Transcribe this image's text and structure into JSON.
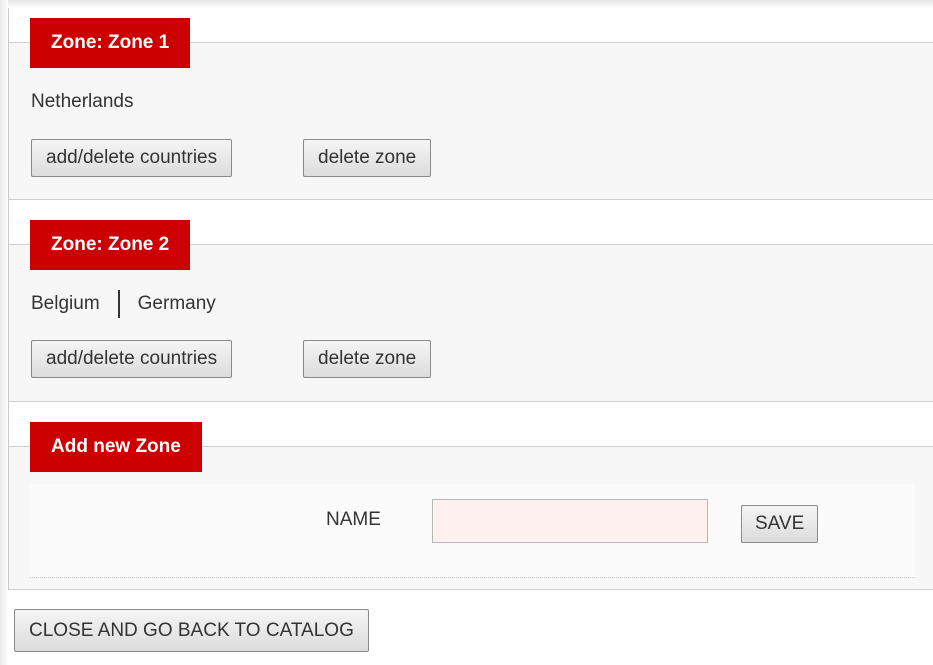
{
  "zones": [
    {
      "header": "Zone: Zone 1",
      "countries": [
        "Netherlands"
      ],
      "add_delete_label": "add/delete countries",
      "delete_label": "delete zone"
    },
    {
      "header": "Zone: Zone 2",
      "countries": [
        "Belgium",
        "Germany"
      ],
      "add_delete_label": "add/delete countries",
      "delete_label": "delete zone"
    }
  ],
  "add_zone": {
    "header": "Add new Zone",
    "name_label": "NAME",
    "name_value": "",
    "save_label": "SAVE"
  },
  "footer": {
    "close_label": "CLOSE AND GO BACK TO CATALOG"
  },
  "colors": {
    "header_red": "#cc0000",
    "input_tint": "#fff1f0"
  }
}
